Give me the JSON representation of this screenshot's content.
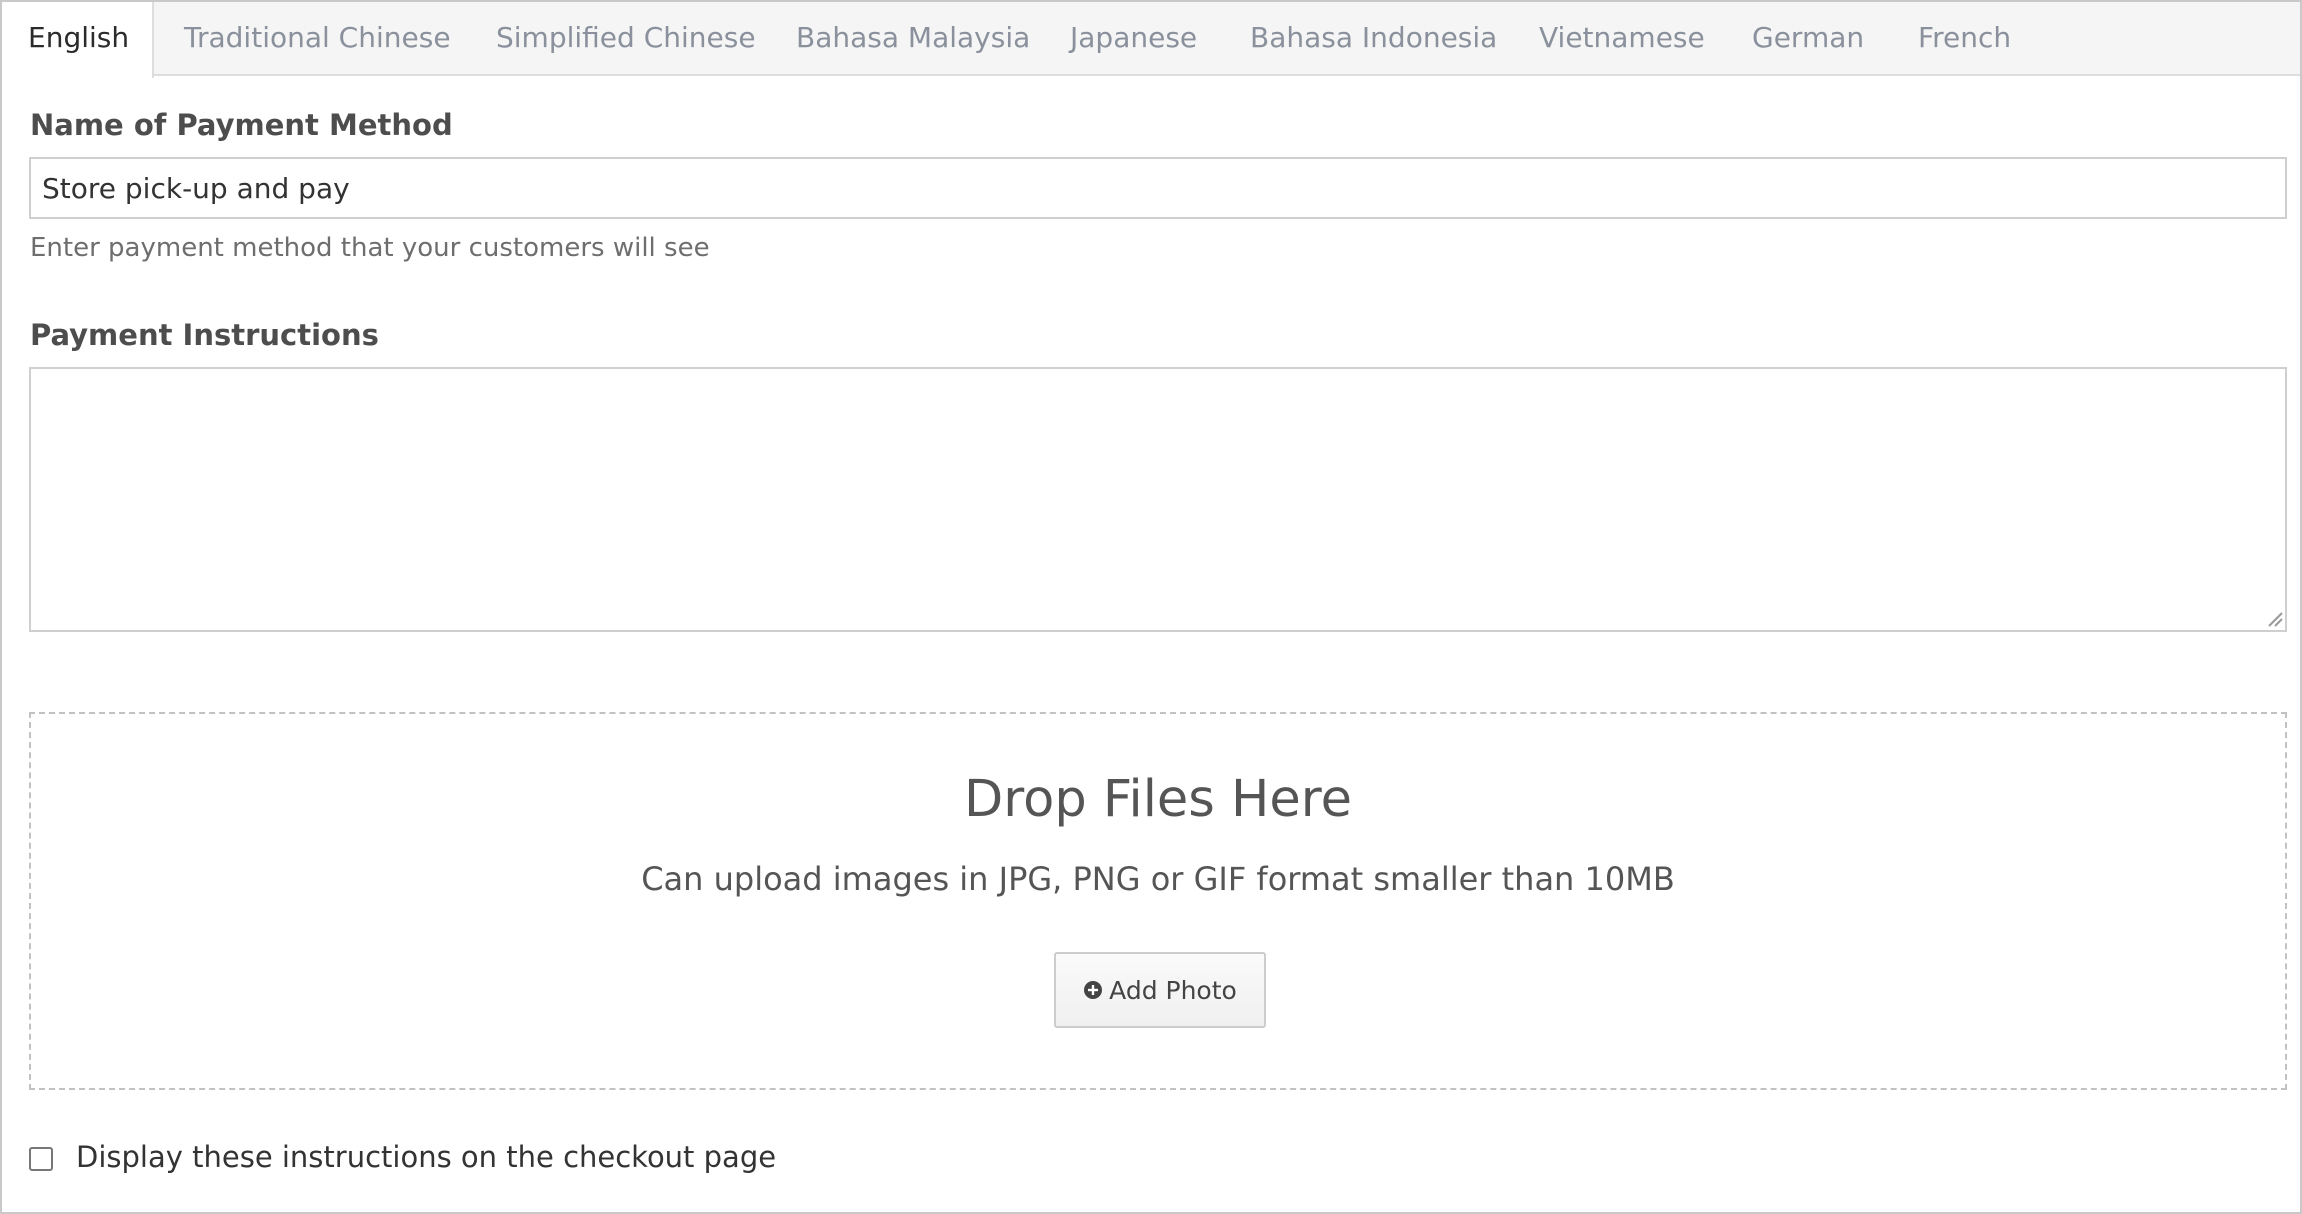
{
  "tabs": [
    {
      "label": "English",
      "active": true
    },
    {
      "label": "Traditional Chinese",
      "active": false
    },
    {
      "label": "Simplified Chinese",
      "active": false
    },
    {
      "label": "Bahasa Malaysia",
      "active": false
    },
    {
      "label": "Japanese",
      "active": false
    },
    {
      "label": "Bahasa Indonesia",
      "active": false
    },
    {
      "label": "Vietnamese",
      "active": false
    },
    {
      "label": "German",
      "active": false
    },
    {
      "label": "French",
      "active": false
    }
  ],
  "form": {
    "name_label": "Name of Payment Method",
    "name_value": "Store pick-up and pay",
    "name_help": "Enter payment method that your customers will see",
    "instructions_label": "Payment Instructions",
    "instructions_value": ""
  },
  "dropzone": {
    "title": "Drop Files Here",
    "subtitle": "Can upload images in JPG, PNG or GIF format smaller than 10MB",
    "button_label": "Add Photo",
    "button_icon": "plus-circle-icon"
  },
  "checkout_option": {
    "label": "Display these instructions on the checkout page",
    "checked": false
  },
  "colors": {
    "tab_inactive_text": "#8a919c",
    "tab_bar_bg": "#f5f5f5",
    "border": "#cfcfcf"
  }
}
